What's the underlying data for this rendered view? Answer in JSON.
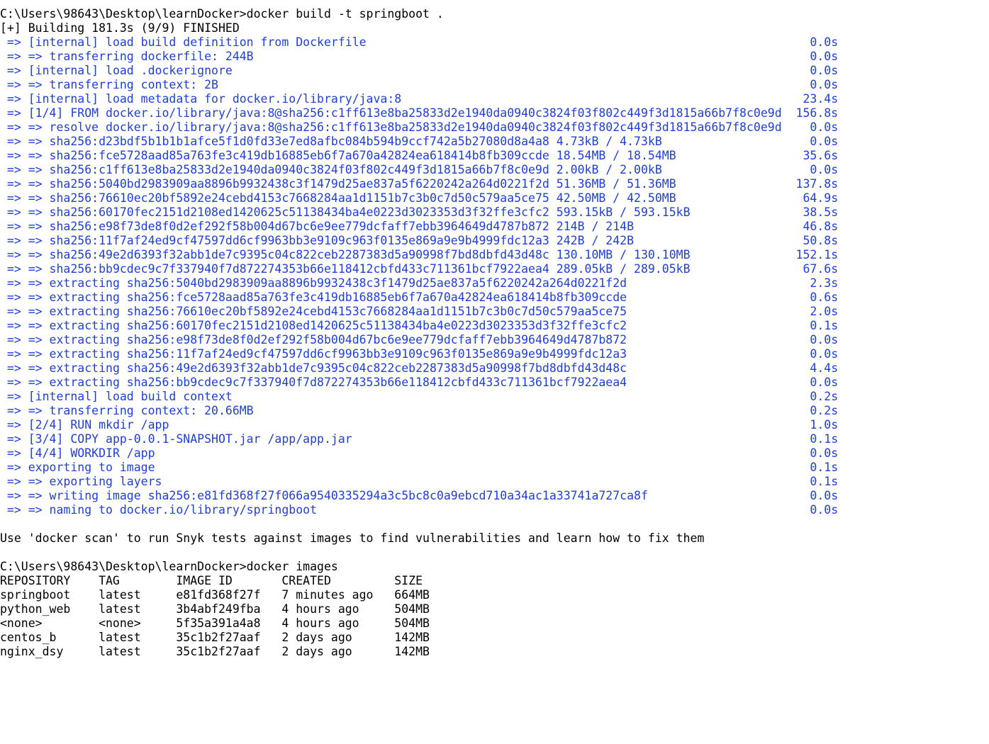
{
  "terminal": {
    "prompt1": "C:\\Users\\98643\\Desktop\\learnDocker>docker build -t springboot .",
    "build_status": "[+] Building 181.3s (9/9) FINISHED",
    "steps": [
      {
        "text": " => [internal] load build definition from Dockerfile",
        "time": "0.0s"
      },
      {
        "text": " => => transferring dockerfile: 244B",
        "time": "0.0s"
      },
      {
        "text": " => [internal] load .dockerignore",
        "time": "0.0s"
      },
      {
        "text": " => => transferring context: 2B",
        "time": "0.0s"
      },
      {
        "text": " => [internal] load metadata for docker.io/library/java:8",
        "time": "23.4s"
      },
      {
        "text": " => [1/4] FROM docker.io/library/java:8@sha256:c1ff613e8ba25833d2e1940da0940c3824f03f802c449f3d1815a66b7f8c0e9d",
        "time": "156.8s"
      },
      {
        "text": " => => resolve docker.io/library/java:8@sha256:c1ff613e8ba25833d2e1940da0940c3824f03f802c449f3d1815a66b7f8c0e9d",
        "time": "0.0s"
      },
      {
        "text": " => => sha256:d23bdf5b1b1b1afce5f1d0fd33e7ed8afbc084b594b9ccf742a5b27080d8a4a8 4.73kB / 4.73kB",
        "time": "0.0s"
      },
      {
        "text": " => => sha256:fce5728aad85a763fe3c419db16885eb6f7a670a42824ea618414b8fb309ccde 18.54MB / 18.54MB",
        "time": "35.6s"
      },
      {
        "text": " => => sha256:c1ff613e8ba25833d2e1940da0940c3824f03f802c449f3d1815a66b7f8c0e9d 2.00kB / 2.00kB",
        "time": "0.0s"
      },
      {
        "text": " => => sha256:5040bd2983909aa8896b9932438c3f1479d25ae837a5f6220242a264d0221f2d 51.36MB / 51.36MB",
        "time": "137.8s"
      },
      {
        "text": " => => sha256:76610ec20bf5892e24cebd4153c7668284aa1d1151b7c3b0c7d50c579aa5ce75 42.50MB / 42.50MB",
        "time": "64.9s"
      },
      {
        "text": " => => sha256:60170fec2151d2108ed1420625c51138434ba4e0223d3023353d3f32ffe3cfc2 593.15kB / 593.15kB",
        "time": "38.5s"
      },
      {
        "text": " => => sha256:e98f73de8f0d2ef292f58b004d67bc6e9ee779dcfaff7ebb3964649d4787b872 214B / 214B",
        "time": "46.8s"
      },
      {
        "text": " => => sha256:11f7af24ed9cf47597dd6cf9963bb3e9109c963f0135e869a9e9b4999fdc12a3 242B / 242B",
        "time": "50.8s"
      },
      {
        "text": " => => sha256:49e2d6393f32abb1de7c9395c04c822ceb2287383d5a90998f7bd8dbfd43d48c 130.10MB / 130.10MB",
        "time": "152.1s"
      },
      {
        "text": " => => sha256:bb9cdec9c7f337940f7d872274353b66e118412cbfd433c711361bcf7922aea4 289.05kB / 289.05kB",
        "time": "67.6s"
      },
      {
        "text": " => => extracting sha256:5040bd2983909aa8896b9932438c3f1479d25ae837a5f6220242a264d0221f2d",
        "time": "2.3s"
      },
      {
        "text": " => => extracting sha256:fce5728aad85a763fe3c419db16885eb6f7a670a42824ea618414b8fb309ccde",
        "time": "0.6s"
      },
      {
        "text": " => => extracting sha256:76610ec20bf5892e24cebd4153c7668284aa1d1151b7c3b0c7d50c579aa5ce75",
        "time": "2.0s"
      },
      {
        "text": " => => extracting sha256:60170fec2151d2108ed1420625c51138434ba4e0223d3023353d3f32ffe3cfc2",
        "time": "0.1s"
      },
      {
        "text": " => => extracting sha256:e98f73de8f0d2ef292f58b004d67bc6e9ee779dcfaff7ebb3964649d4787b872",
        "time": "0.0s"
      },
      {
        "text": " => => extracting sha256:11f7af24ed9cf47597dd6cf9963bb3e9109c963f0135e869a9e9b4999fdc12a3",
        "time": "0.0s"
      },
      {
        "text": " => => extracting sha256:49e2d6393f32abb1de7c9395c04c822ceb2287383d5a90998f7bd8dbfd43d48c",
        "time": "4.4s"
      },
      {
        "text": " => => extracting sha256:bb9cdec9c7f337940f7d872274353b66e118412cbfd433c711361bcf7922aea4",
        "time": "0.0s"
      },
      {
        "text": " => [internal] load build context",
        "time": "0.2s"
      },
      {
        "text": " => => transferring context: 20.66MB",
        "time": "0.2s"
      },
      {
        "text": " => [2/4] RUN mkdir /app",
        "time": "1.0s"
      },
      {
        "text": " => [3/4] COPY app-0.0.1-SNAPSHOT.jar /app/app.jar",
        "time": "0.1s"
      },
      {
        "text": " => [4/4] WORKDIR /app",
        "time": "0.0s"
      },
      {
        "text": " => exporting to image",
        "time": "0.1s"
      },
      {
        "text": " => => exporting layers",
        "time": "0.1s"
      },
      {
        "text": " => => writing image sha256:e81fd368f27f066a9540335294a3c5bc8c0a9ebcd710a34ac1a33741a727ca8f",
        "time": "0.0s"
      },
      {
        "text": " => => naming to docker.io/library/springboot",
        "time": "0.0s"
      }
    ],
    "snyk_hint": "Use 'docker scan' to run Snyk tests against images to find vulnerabilities and learn how to fix them",
    "prompt2": "C:\\Users\\98643\\Desktop\\learnDocker>docker images",
    "images_table": {
      "headers": [
        "REPOSITORY",
        "TAG",
        "IMAGE ID",
        "CREATED",
        "SIZE"
      ],
      "rows": [
        [
          "springboot",
          "latest",
          "e81fd368f27f",
          "7 minutes ago",
          "664MB"
        ],
        [
          "python_web",
          "latest",
          "3b4abf249fba",
          "4 hours ago",
          "504MB"
        ],
        [
          "<none>",
          "<none>",
          "5f35a391a4a8",
          "4 hours ago",
          "504MB"
        ],
        [
          "centos_b",
          "latest",
          "35c1b2f27aaf",
          "2 days ago",
          "142MB"
        ],
        [
          "nginx_dsy",
          "latest",
          "35c1b2f27aaf",
          "2 days ago",
          "142MB"
        ]
      ]
    }
  },
  "colors": {
    "background": "#ffffff",
    "text": "#000000",
    "build_output": "#1f3fd8"
  }
}
